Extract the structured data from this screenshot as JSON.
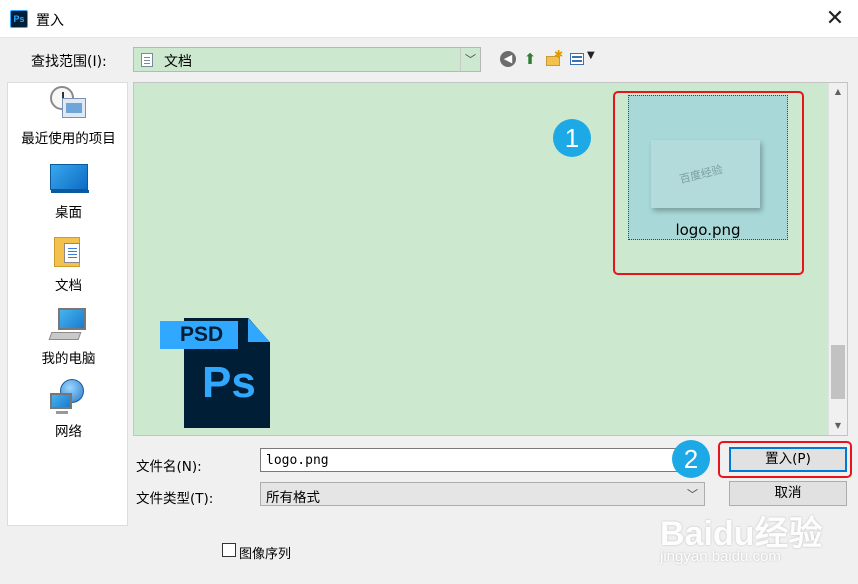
{
  "window": {
    "app_icon_text": "Ps",
    "title": "置入",
    "close_glyph": "✕"
  },
  "lookin": {
    "label": "查找范围(I):",
    "value": "文档",
    "folder_icon": "document-folder-icon",
    "arrow": "﹀"
  },
  "toolbar": {
    "back_glyph": "◀",
    "up_glyph": "⬆",
    "new_folder_glyph": "✱",
    "views_arrow": "▼"
  },
  "places": [
    {
      "label": "最近使用的项目",
      "icon": "recent-items-icon"
    },
    {
      "label": "桌面",
      "icon": "desktop-icon"
    },
    {
      "label": "文档",
      "icon": "documents-icon"
    },
    {
      "label": "我的电脑",
      "icon": "computer-icon"
    },
    {
      "label": "网络",
      "icon": "network-icon"
    }
  ],
  "files": [
    {
      "name": "logo.png",
      "thumb_text": "百度经验",
      "selected": true
    }
  ],
  "logo": {
    "psd_label": "PSD",
    "ps_label": "Ps"
  },
  "form": {
    "filename_label": "文件名(N):",
    "filename_value": "logo.png",
    "filetype_label": "文件类型(T):",
    "filetype_value": "所有格式",
    "place_button": "置入(P)",
    "cancel_button": "取消",
    "image_sequence_label": "图像序列",
    "image_sequence_checked": false
  },
  "callouts": {
    "one": "1",
    "two": "2"
  },
  "watermark": {
    "logo": "Baidu经验",
    "url": "jingyan.baidu.com"
  },
  "colors": {
    "pane_bg": "#cce8cf",
    "accent": "#0078d7",
    "callout": "#e8141b",
    "badge": "#1ca9e6"
  }
}
